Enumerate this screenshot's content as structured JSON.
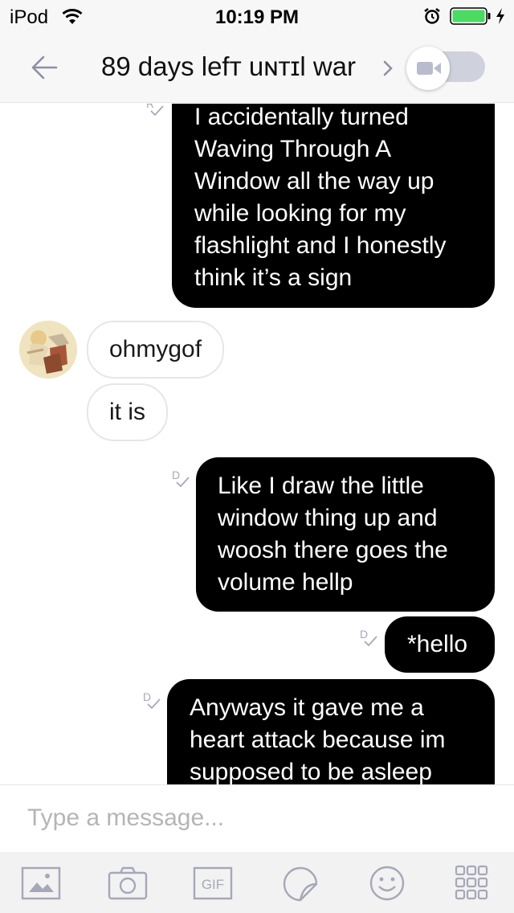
{
  "status_bar": {
    "carrier": "iPod",
    "time": "10:19 PM",
    "icons": [
      "wifi-icon",
      "alarm-icon",
      "battery-icon",
      "charging-icon"
    ],
    "battery_color": "#4cd964"
  },
  "header": {
    "title": "89 days lefᴛ uɴᴛɪl war",
    "icons": [
      "back-arrow-icon",
      "chevron-right-icon",
      "video-camera-icon"
    ],
    "video_toggle_on": false
  },
  "messages": [
    {
      "direction": "outgoing",
      "receipt": "R",
      "lines": [
        "I accidentally turned",
        "Waving Through A",
        "Window all the way up",
        "while looking for my",
        "flashlight and I honestly",
        "think it’s a sign"
      ]
    },
    {
      "direction": "incoming",
      "lines": [
        "ohmygof"
      ]
    },
    {
      "direction": "incoming",
      "lines": [
        "it is"
      ]
    },
    {
      "direction": "outgoing",
      "receipt": "D",
      "lines": [
        "Like I draw the little",
        "window thing up and",
        "woosh there goes the",
        "volume hellp"
      ]
    },
    {
      "direction": "outgoing",
      "receipt": "D",
      "lines": [
        "*hello"
      ]
    },
    {
      "direction": "outgoing",
      "receipt": "D",
      "lines": [
        "Anyways it gave me a",
        "heart attack because im",
        "supposed to be asleep"
      ]
    }
  ],
  "composer": {
    "placeholder": "Type a message...",
    "value": ""
  },
  "toolbar": {
    "items": [
      {
        "icon": "image-icon"
      },
      {
        "icon": "camera-icon"
      },
      {
        "icon": "gif-icon",
        "label": "GIF"
      },
      {
        "icon": "sticker-icon"
      },
      {
        "icon": "emoji-icon"
      },
      {
        "icon": "apps-grid-icon"
      }
    ]
  },
  "colors": {
    "outgoing_bubble": "#000000",
    "outgoing_text": "#ffffff",
    "incoming_border": "#e6e6e6",
    "icon_gray": "#a6a8b8"
  }
}
